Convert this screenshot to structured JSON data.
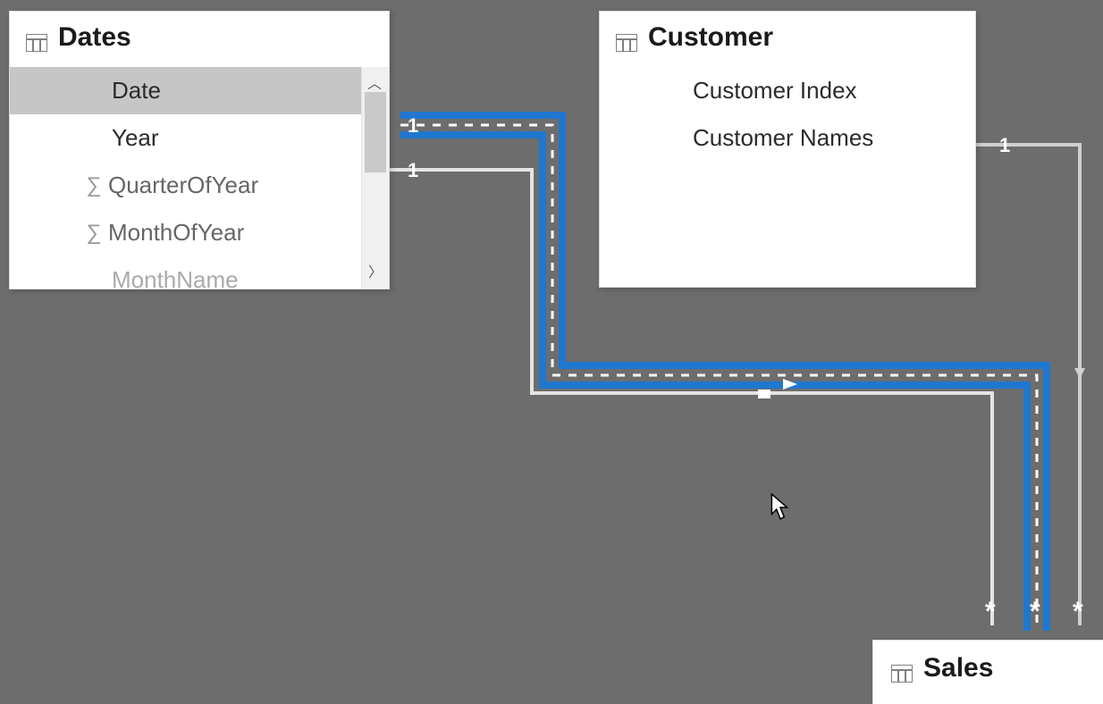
{
  "tables": {
    "dates": {
      "title": "Dates",
      "fields": [
        "Date",
        "Year",
        "QuarterOfYear",
        "MonthOfYear",
        "MonthName"
      ],
      "aggregated": [
        "QuarterOfYear",
        "MonthOfYear"
      ],
      "selected": "Date"
    },
    "customer": {
      "title": "Customer",
      "fields": [
        "Customer Index",
        "Customer Names"
      ]
    },
    "sales": {
      "title": "Sales"
    }
  },
  "relationships": [
    {
      "from": "Dates",
      "to": "Sales",
      "fromCard": "1",
      "toCard": "*",
      "active": false,
      "selected": true
    },
    {
      "from": "Dates",
      "to": "Sales",
      "fromCard": "1",
      "toCard": "*",
      "active": true,
      "selected": false
    },
    {
      "from": "Customer",
      "to": "Sales",
      "fromCard": "1",
      "toCard": "*",
      "active": true,
      "selected": false
    }
  ],
  "colors": {
    "selection": "#1f77d0",
    "canvas": "#6d6d6d",
    "card": "#ffffff"
  }
}
